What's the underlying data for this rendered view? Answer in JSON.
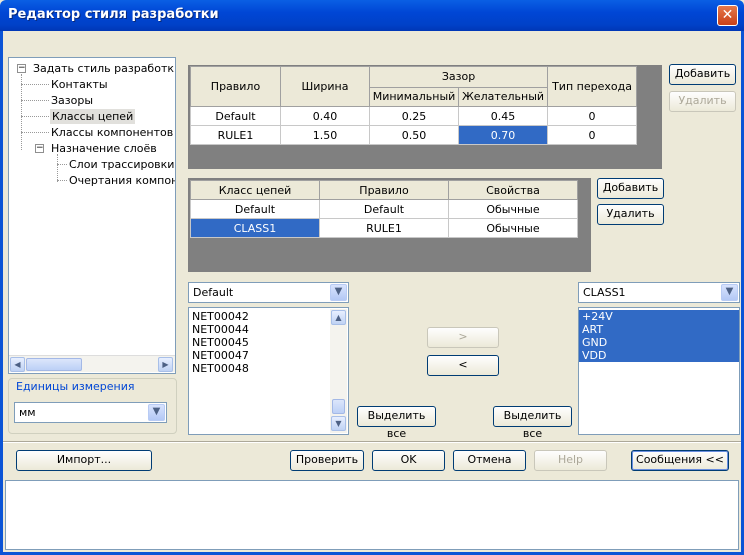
{
  "window": {
    "title": "Редактор стиля разработки",
    "close_glyph": "✕"
  },
  "tree": {
    "items": [
      {
        "label": "Задать стиль разработки",
        "expander": "−"
      },
      {
        "label": "Контакты"
      },
      {
        "label": "Зазоры"
      },
      {
        "label": "Классы цепей"
      },
      {
        "label": "Классы компонентов"
      },
      {
        "label": "Назначение слоёв",
        "expander": "−"
      },
      {
        "label": "Слои трассировки"
      },
      {
        "label": "Очертания компонентов"
      }
    ],
    "selected": "Классы цепей"
  },
  "units": {
    "group_label": "Единицы измерения",
    "value": "мм"
  },
  "rules_table": {
    "headers": {
      "rule": "Правило",
      "width": "Ширина",
      "gap": "Зазор",
      "gap_min": "Минимальный",
      "gap_pref": "Желательный",
      "via": "Тип перехода"
    },
    "rows": [
      {
        "rule": "Default",
        "width": "0.40",
        "min": "0.25",
        "pref": "0.45",
        "via": "0"
      },
      {
        "rule": "RULE1",
        "width": "1.50",
        "min": "0.50",
        "pref": "0.70",
        "via": "0"
      }
    ],
    "add_label": "Добавить",
    "delete_label": "Удалить"
  },
  "class_table": {
    "headers": {
      "class": "Класс цепей",
      "rule": "Правило",
      "props": "Свойства"
    },
    "rows": [
      {
        "class": "Default",
        "rule": "Default",
        "props": "Обычные"
      },
      {
        "class": "CLASS1",
        "rule": "RULE1",
        "props": "Обычные"
      }
    ],
    "add_label": "Добавить",
    "delete_label": "Удалить"
  },
  "left_list": {
    "combo_value": "Default",
    "items": [
      "NET00042",
      "NET00044",
      "NET00045",
      "NET00047",
      "NET00048"
    ],
    "select_all_label": "Выделить все"
  },
  "right_list": {
    "combo_value": "CLASS1",
    "items": [
      "+24V",
      "ART",
      "GND",
      "VDD"
    ],
    "select_all_label": "Выделить все"
  },
  "transfer": {
    "move_right": ">",
    "move_left": "<"
  },
  "footer": {
    "import_label": "Импорт...",
    "check_label": "Проверить",
    "ok_label": "OK",
    "cancel_label": "Отмена",
    "help_label": "Help",
    "messages_label": "Сообщения <<"
  },
  "colors": {
    "titlebar": "#0046d5",
    "selection": "#316ac5",
    "dialog_bg": "#ece9d8"
  }
}
